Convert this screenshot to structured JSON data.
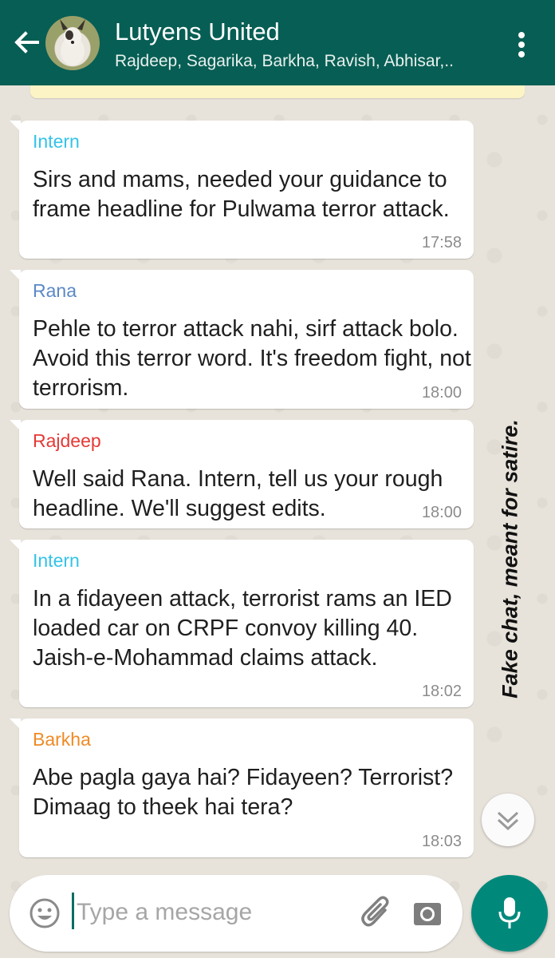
{
  "header": {
    "title": "Lutyens United",
    "subtitle": "Rajdeep, Sagarika, Barkha, Ravish, Abhisar,..",
    "back_icon": "arrow-left-icon",
    "menu_icon": "more-vert-icon"
  },
  "messages": [
    {
      "sender": "Intern",
      "sender_color": "#34c3e8",
      "text": "Sirs and mams, needed your guidance to frame headline for Pulwama terror attack.",
      "time": "17:58"
    },
    {
      "sender": "Rana",
      "sender_color": "#5b88c7",
      "text": "Pehle to terror attack nahi, sirf attack bolo. Avoid this terror word. It's freedom fight, not terrorism.",
      "time": "18:00"
    },
    {
      "sender": "Rajdeep",
      "sender_color": "#e53935",
      "text": "Well said Rana. Intern, tell us your rough headline. We'll suggest edits.",
      "time": "18:00"
    },
    {
      "sender": "Intern",
      "sender_color": "#34c3e8",
      "text": "In a fidayeen attack, terrorist rams an IED loaded car on CRPF convoy killing 40. Jaish-e-Mohammad claims attack.",
      "time": "18:02"
    },
    {
      "sender": "Barkha",
      "sender_color": "#f08a24",
      "text": "Abe pagla gaya hai? Fidayeen? Terrorist? Dimaag to theek hai tera?",
      "time": "18:03"
    }
  ],
  "watermark": "Fake chat, meant for satire.",
  "composer": {
    "placeholder": "Type a message",
    "emoji_icon": "emoji-icon",
    "attach_icon": "paperclip-icon",
    "camera_icon": "camera-icon",
    "mic_icon": "microphone-icon"
  },
  "colors": {
    "header_bg": "#075e54",
    "accent": "#00897b",
    "bubble_bg": "#ffffff"
  }
}
